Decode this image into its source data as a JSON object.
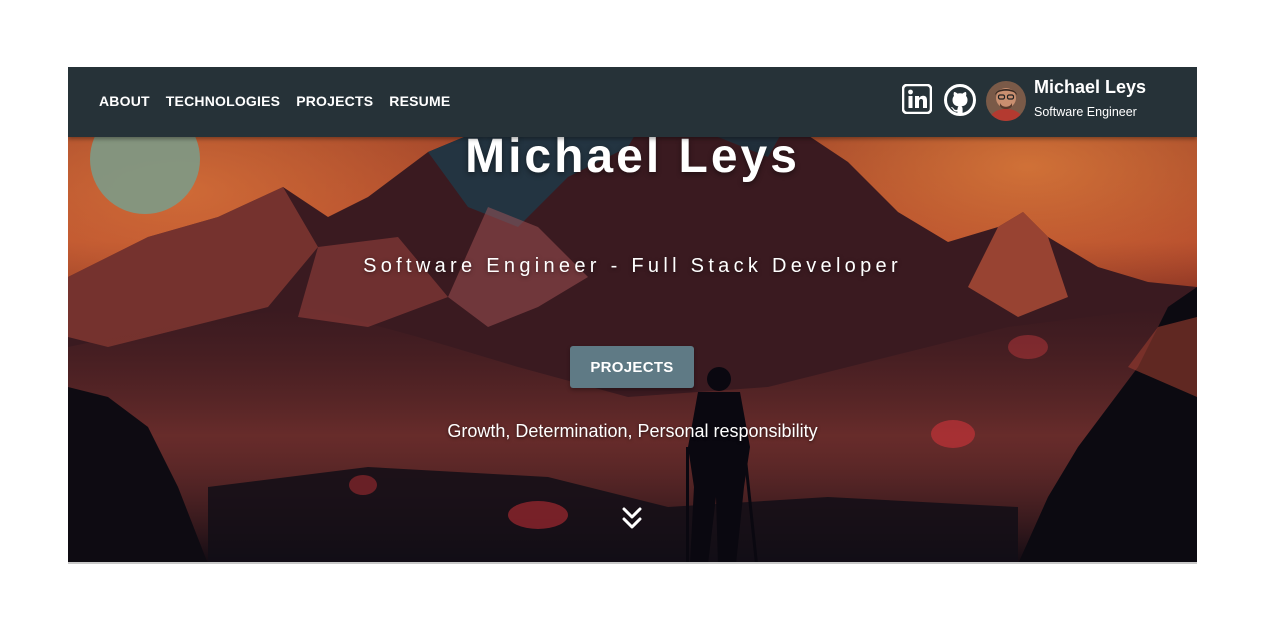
{
  "nav": {
    "links": [
      "ABOUT",
      "TECHNOLOGIES",
      "PROJECTS",
      "RESUME"
    ]
  },
  "profile": {
    "name": "Michael Leys",
    "role": "Software Engineer"
  },
  "icons": {
    "linkedin": "linkedin-icon",
    "github": "github-icon",
    "scroll": "double-chevron-down-icon"
  },
  "hero": {
    "title": "Michael Leys",
    "subtitle": "Software Engineer - Full Stack Developer",
    "button_label": "PROJECTS",
    "tagline": "Growth, Determination, Personal responsibility"
  },
  "colors": {
    "navbar": "#263238",
    "button": "#5f7a85",
    "text": "#ffffff"
  }
}
